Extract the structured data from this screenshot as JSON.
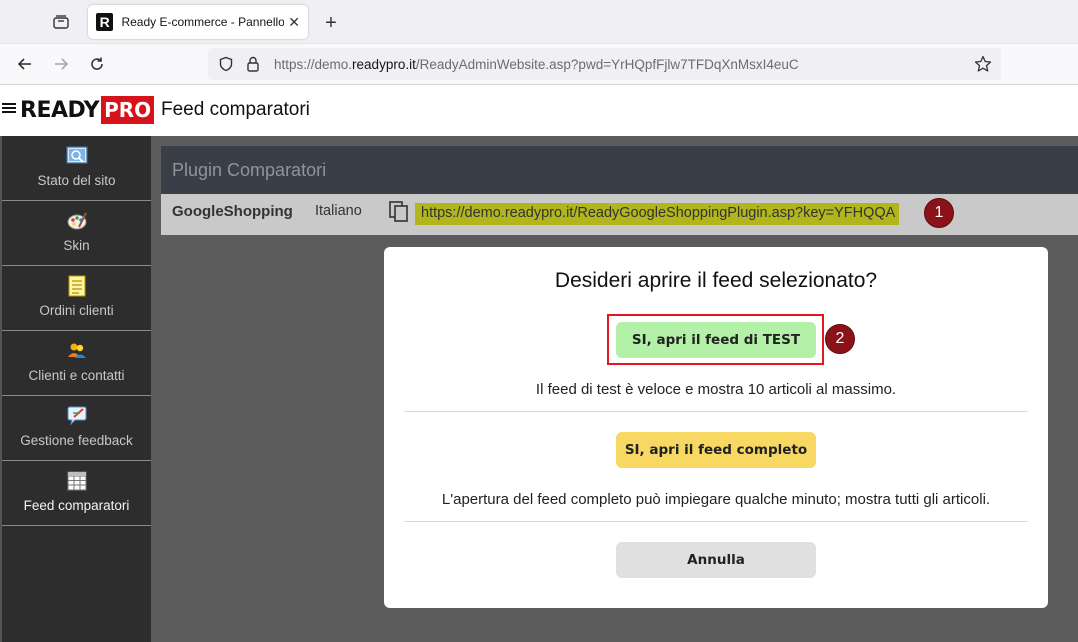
{
  "browser": {
    "tab_title": "Ready E-commerce - Pannello",
    "favicon_letter": "R",
    "url_prefix": "https://demo.",
    "url_host": "readypro.it",
    "url_path": "/ReadyAdminWebsite.asp?pwd=YrHQpfFjlw7TFDqXnMsxI4euC"
  },
  "header": {
    "logo_ready": "READY",
    "logo_pro": "PRO",
    "page_title": "Feed comparatori"
  },
  "sidebar": {
    "items": [
      {
        "label": "Stato del sito",
        "icon": "site-status-icon"
      },
      {
        "label": "Skin",
        "icon": "palette-icon"
      },
      {
        "label": "Ordini clienti",
        "icon": "notepad-icon"
      },
      {
        "label": "Clienti e contatti",
        "icon": "users-icon"
      },
      {
        "label": "Gestione feedback",
        "icon": "feedback-icon"
      },
      {
        "label": "Feed comparatori",
        "icon": "grid-icon",
        "active": true
      }
    ]
  },
  "main": {
    "panel_title": "Plugin Comparatori",
    "plugin": {
      "name": "GoogleShopping",
      "language": "Italiano",
      "feed_url": "https://demo.readypro.it/ReadyGoogleShoppingPlugin.asp?key=YFHQQA"
    }
  },
  "markers": [
    "1",
    "2"
  ],
  "modal": {
    "title": "Desideri aprire il feed selezionato?",
    "test_button": "SI, apri il feed di TEST",
    "test_note": "Il feed di test è veloce e mostra 10 articoli al massimo.",
    "full_button": "SI, apri il feed completo",
    "full_note": "L'apertura del feed completo può impiegare qualche minuto; mostra tutti gli articoli.",
    "cancel_button": "Annulla"
  },
  "colors": {
    "test_button": "#b4f1a8",
    "full_button": "#f6d862",
    "cancel_button": "#e0e0e0",
    "highlight": "#e0181f",
    "marker": "#8b1219",
    "url_highlight": "#b2b61c",
    "brand_red": "#d6121a"
  }
}
